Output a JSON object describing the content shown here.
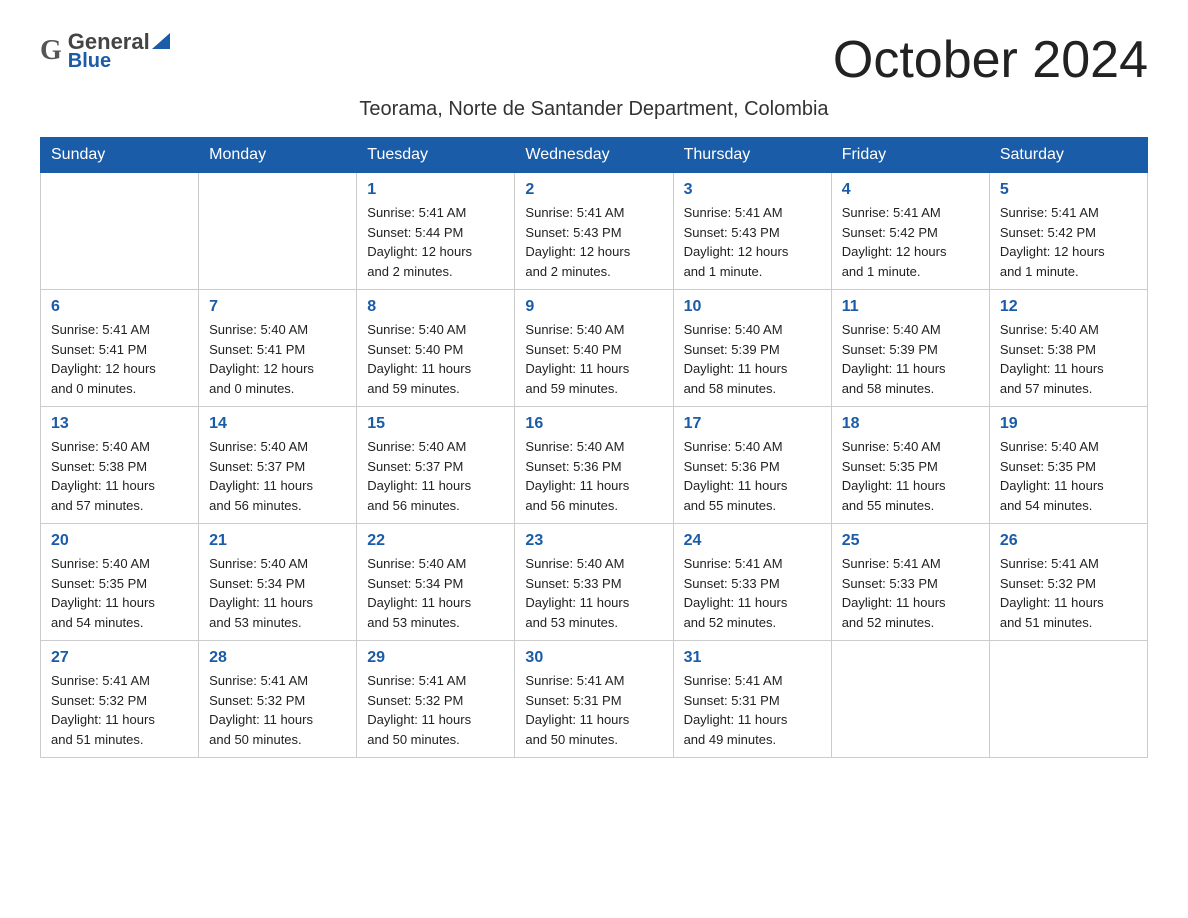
{
  "header": {
    "logo_general": "General",
    "logo_blue": "Blue",
    "month_title": "October 2024",
    "location": "Teorama, Norte de Santander Department, Colombia"
  },
  "days_of_week": [
    "Sunday",
    "Monday",
    "Tuesday",
    "Wednesday",
    "Thursday",
    "Friday",
    "Saturday"
  ],
  "weeks": [
    [
      {
        "day": "",
        "info": ""
      },
      {
        "day": "",
        "info": ""
      },
      {
        "day": "1",
        "info": "Sunrise: 5:41 AM\nSunset: 5:44 PM\nDaylight: 12 hours\nand 2 minutes."
      },
      {
        "day": "2",
        "info": "Sunrise: 5:41 AM\nSunset: 5:43 PM\nDaylight: 12 hours\nand 2 minutes."
      },
      {
        "day": "3",
        "info": "Sunrise: 5:41 AM\nSunset: 5:43 PM\nDaylight: 12 hours\nand 1 minute."
      },
      {
        "day": "4",
        "info": "Sunrise: 5:41 AM\nSunset: 5:42 PM\nDaylight: 12 hours\nand 1 minute."
      },
      {
        "day": "5",
        "info": "Sunrise: 5:41 AM\nSunset: 5:42 PM\nDaylight: 12 hours\nand 1 minute."
      }
    ],
    [
      {
        "day": "6",
        "info": "Sunrise: 5:41 AM\nSunset: 5:41 PM\nDaylight: 12 hours\nand 0 minutes."
      },
      {
        "day": "7",
        "info": "Sunrise: 5:40 AM\nSunset: 5:41 PM\nDaylight: 12 hours\nand 0 minutes."
      },
      {
        "day": "8",
        "info": "Sunrise: 5:40 AM\nSunset: 5:40 PM\nDaylight: 11 hours\nand 59 minutes."
      },
      {
        "day": "9",
        "info": "Sunrise: 5:40 AM\nSunset: 5:40 PM\nDaylight: 11 hours\nand 59 minutes."
      },
      {
        "day": "10",
        "info": "Sunrise: 5:40 AM\nSunset: 5:39 PM\nDaylight: 11 hours\nand 58 minutes."
      },
      {
        "day": "11",
        "info": "Sunrise: 5:40 AM\nSunset: 5:39 PM\nDaylight: 11 hours\nand 58 minutes."
      },
      {
        "day": "12",
        "info": "Sunrise: 5:40 AM\nSunset: 5:38 PM\nDaylight: 11 hours\nand 57 minutes."
      }
    ],
    [
      {
        "day": "13",
        "info": "Sunrise: 5:40 AM\nSunset: 5:38 PM\nDaylight: 11 hours\nand 57 minutes."
      },
      {
        "day": "14",
        "info": "Sunrise: 5:40 AM\nSunset: 5:37 PM\nDaylight: 11 hours\nand 56 minutes."
      },
      {
        "day": "15",
        "info": "Sunrise: 5:40 AM\nSunset: 5:37 PM\nDaylight: 11 hours\nand 56 minutes."
      },
      {
        "day": "16",
        "info": "Sunrise: 5:40 AM\nSunset: 5:36 PM\nDaylight: 11 hours\nand 56 minutes."
      },
      {
        "day": "17",
        "info": "Sunrise: 5:40 AM\nSunset: 5:36 PM\nDaylight: 11 hours\nand 55 minutes."
      },
      {
        "day": "18",
        "info": "Sunrise: 5:40 AM\nSunset: 5:35 PM\nDaylight: 11 hours\nand 55 minutes."
      },
      {
        "day": "19",
        "info": "Sunrise: 5:40 AM\nSunset: 5:35 PM\nDaylight: 11 hours\nand 54 minutes."
      }
    ],
    [
      {
        "day": "20",
        "info": "Sunrise: 5:40 AM\nSunset: 5:35 PM\nDaylight: 11 hours\nand 54 minutes."
      },
      {
        "day": "21",
        "info": "Sunrise: 5:40 AM\nSunset: 5:34 PM\nDaylight: 11 hours\nand 53 minutes."
      },
      {
        "day": "22",
        "info": "Sunrise: 5:40 AM\nSunset: 5:34 PM\nDaylight: 11 hours\nand 53 minutes."
      },
      {
        "day": "23",
        "info": "Sunrise: 5:40 AM\nSunset: 5:33 PM\nDaylight: 11 hours\nand 53 minutes."
      },
      {
        "day": "24",
        "info": "Sunrise: 5:41 AM\nSunset: 5:33 PM\nDaylight: 11 hours\nand 52 minutes."
      },
      {
        "day": "25",
        "info": "Sunrise: 5:41 AM\nSunset: 5:33 PM\nDaylight: 11 hours\nand 52 minutes."
      },
      {
        "day": "26",
        "info": "Sunrise: 5:41 AM\nSunset: 5:32 PM\nDaylight: 11 hours\nand 51 minutes."
      }
    ],
    [
      {
        "day": "27",
        "info": "Sunrise: 5:41 AM\nSunset: 5:32 PM\nDaylight: 11 hours\nand 51 minutes."
      },
      {
        "day": "28",
        "info": "Sunrise: 5:41 AM\nSunset: 5:32 PM\nDaylight: 11 hours\nand 50 minutes."
      },
      {
        "day": "29",
        "info": "Sunrise: 5:41 AM\nSunset: 5:32 PM\nDaylight: 11 hours\nand 50 minutes."
      },
      {
        "day": "30",
        "info": "Sunrise: 5:41 AM\nSunset: 5:31 PM\nDaylight: 11 hours\nand 50 minutes."
      },
      {
        "day": "31",
        "info": "Sunrise: 5:41 AM\nSunset: 5:31 PM\nDaylight: 11 hours\nand 49 minutes."
      },
      {
        "day": "",
        "info": ""
      },
      {
        "day": "",
        "info": ""
      }
    ]
  ],
  "colors": {
    "header_bg": "#1a5ca8",
    "header_text": "#ffffff",
    "day_number_color": "#1a5ca8",
    "border_color": "#cccccc",
    "logo_blue": "#1a5ca8"
  }
}
